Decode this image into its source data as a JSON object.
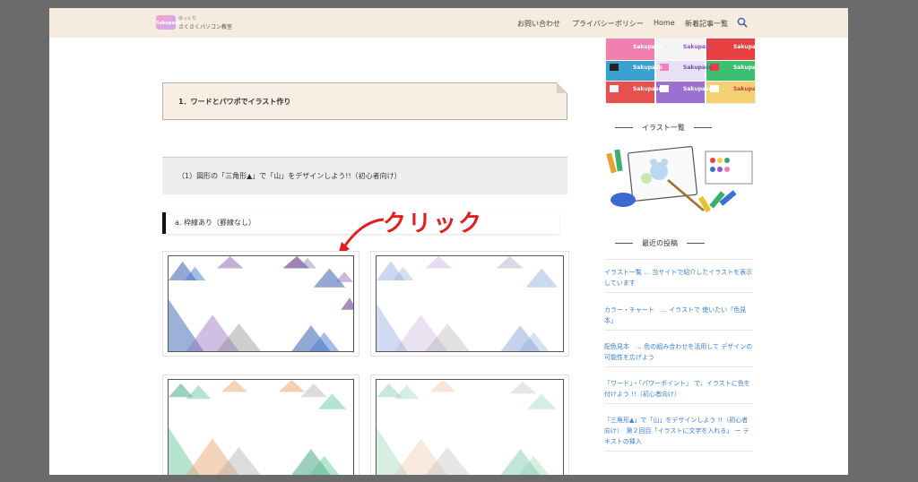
{
  "header": {
    "logo_text": "Sakupaso",
    "brand_sub": "ゆっくり",
    "brand": "さくさくパソコン教室",
    "nav": [
      "お問い合わせ",
      "プライバシーポリシー",
      "Home",
      "新着記事一覧"
    ]
  },
  "content": {
    "heading1": "1．ワードとパワポでイラスト作り",
    "heading2": "（1）図形の「三角形▲」で「山」をデザインしよう!!（初心者向け）",
    "heading3": "a. 枠線あり（罫線なし）",
    "annotation": "クリック"
  },
  "sidebar": {
    "banner_text": "Sakupaso",
    "illust_title": "イラスト一覧",
    "recent_title": "最近の投稿",
    "posts": [
      "イラスト一覧 … 当サイトで紹介したイラストを表示しています",
      "カラー・チャート　… イラストで 使いたい「色見本」",
      "配色見本　… 色の組み合わせを活用して デザインの可能性を広げよう",
      "「ワード」・「パワーポイント」 で、イラストに色を付けよう !!（初心者向け）",
      "「三角形▲」で「山」をデザインしよう !!（初心者向け）　第２回目「イラストに文字を入れる」 ー テキストの挿入"
    ]
  },
  "colors": {
    "accent_red": "#e02020",
    "link_blue": "#3b7fd0",
    "header_bg": "#f5ebdf"
  }
}
